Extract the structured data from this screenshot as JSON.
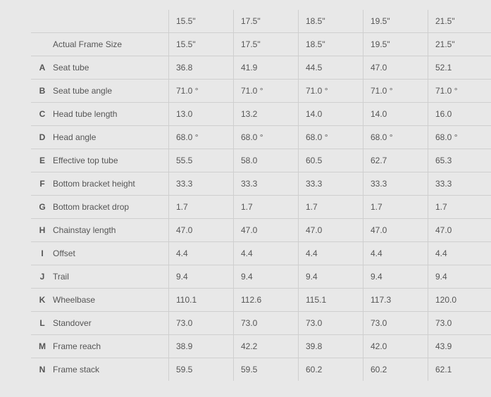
{
  "sizes": [
    "15.5\"",
    "17.5\"",
    "18.5\"",
    "19.5\"",
    "21.5\""
  ],
  "rows": [
    {
      "letter": "",
      "label": "Actual Frame Size",
      "values": [
        "15.5\"",
        "17.5\"",
        "18.5\"",
        "19.5\"",
        "21.5\""
      ]
    },
    {
      "letter": "A",
      "label": "Seat tube",
      "values": [
        "36.8",
        "41.9",
        "44.5",
        "47.0",
        "52.1"
      ]
    },
    {
      "letter": "B",
      "label": "Seat tube angle",
      "values": [
        "71.0 °",
        "71.0 °",
        "71.0 °",
        "71.0 °",
        "71.0 °"
      ]
    },
    {
      "letter": "C",
      "label": "Head tube length",
      "values": [
        "13.0",
        "13.2",
        "14.0",
        "14.0",
        "16.0"
      ]
    },
    {
      "letter": "D",
      "label": "Head angle",
      "values": [
        "68.0 °",
        "68.0 °",
        "68.0 °",
        "68.0 °",
        "68.0 °"
      ]
    },
    {
      "letter": "E",
      "label": "Effective top tube",
      "values": [
        "55.5",
        "58.0",
        "60.5",
        "62.7",
        "65.3"
      ]
    },
    {
      "letter": "F",
      "label": "Bottom bracket height",
      "values": [
        "33.3",
        "33.3",
        "33.3",
        "33.3",
        "33.3"
      ]
    },
    {
      "letter": "G",
      "label": "Bottom bracket drop",
      "values": [
        "1.7",
        "1.7",
        "1.7",
        "1.7",
        "1.7"
      ]
    },
    {
      "letter": "H",
      "label": "Chainstay length",
      "values": [
        "47.0",
        "47.0",
        "47.0",
        "47.0",
        "47.0"
      ]
    },
    {
      "letter": "I",
      "label": "Offset",
      "values": [
        "4.4",
        "4.4",
        "4.4",
        "4.4",
        "4.4"
      ]
    },
    {
      "letter": "J",
      "label": "Trail",
      "values": [
        "9.4",
        "9.4",
        "9.4",
        "9.4",
        "9.4"
      ]
    },
    {
      "letter": "K",
      "label": "Wheelbase",
      "values": [
        "110.1",
        "112.6",
        "115.1",
        "117.3",
        "120.0"
      ]
    },
    {
      "letter": "L",
      "label": "Standover",
      "values": [
        "73.0",
        "73.0",
        "73.0",
        "73.0",
        "73.0"
      ]
    },
    {
      "letter": "M",
      "label": "Frame reach",
      "values": [
        "38.9",
        "42.2",
        "39.8",
        "42.0",
        "43.9"
      ]
    },
    {
      "letter": "N",
      "label": "Frame stack",
      "values": [
        "59.5",
        "59.5",
        "60.2",
        "60.2",
        "62.1"
      ]
    }
  ]
}
